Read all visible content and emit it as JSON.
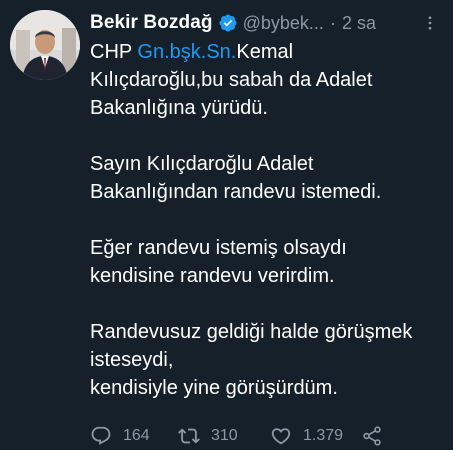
{
  "author": {
    "name": "Bekir  Bozdağ",
    "handle": "@bybek...",
    "separator": "·",
    "time": "2 sa"
  },
  "tweet": {
    "line1_prefix": "CHP ",
    "line1_mention": "Gn.bşk.Sn.",
    "line1_suffix": "Kemal",
    "line2": "Kılıçdaroğlu,bu sabah da Adalet",
    "line3": "Bakanlığına yürüdü.",
    "para2_line1": "Sayın Kılıçdaroğlu Adalet",
    "para2_line2": "Bakanlığından randevu istemedi.",
    "para3_line1": "Eğer randevu istemiş olsaydı",
    "para3_line2": "kendisine randevu verirdim.",
    "para4_line1": "Randevusuz geldiği halde görüşmek",
    "para4_line2": "isteseydi,",
    "para4_line3": "kendisiyle yine görüşürdüm."
  },
  "actions": {
    "replies": "164",
    "retweets": "310",
    "likes": "1.379"
  },
  "colors": {
    "background": "#15202b",
    "text": "#ffffff",
    "muted": "#8b98a5",
    "accent": "#1d9bf0"
  },
  "icons": {
    "verified": "verified-badge-icon",
    "more": "more-options-icon",
    "reply": "reply-icon",
    "retweet": "retweet-icon",
    "like": "heart-icon",
    "share": "share-icon"
  }
}
